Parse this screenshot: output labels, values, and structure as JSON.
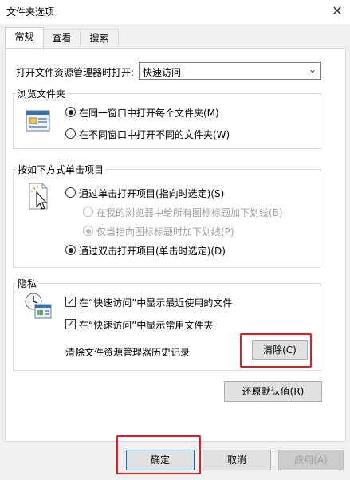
{
  "window": {
    "title": "文件夹选项",
    "close_glyph": "✕"
  },
  "tabs": [
    {
      "label": "常规",
      "active": true
    },
    {
      "label": "查看",
      "active": false
    },
    {
      "label": "搜索",
      "active": false
    }
  ],
  "open_explorer": {
    "label": "打开文件资源管理器时打开:",
    "value": "快速访问"
  },
  "browse_folders": {
    "title": "浏览文件夹",
    "options": [
      {
        "label": "在同一窗口中打开每个文件夹(M)",
        "selected": true
      },
      {
        "label": "在不同窗口中打开不同的文件夹(W)",
        "selected": false
      }
    ]
  },
  "click_items": {
    "title": "按如下方式单击项目",
    "single": {
      "label": "通过单击打开项目(指向时选定)(S)",
      "selected": false
    },
    "sub_underline_all": {
      "label": "在我的浏览器中给所有图标标题加下划线(B)",
      "selected": false
    },
    "sub_underline_hover": {
      "label": "仅当指向图标标题时加下划线(P)",
      "selected": true
    },
    "double": {
      "label": "通过双击打开项目(单击时选定)(D)",
      "selected": true
    }
  },
  "privacy": {
    "title": "隐私",
    "show_recent": {
      "label": "在“快速访问”中显示最近使用的文件",
      "checked": true
    },
    "show_frequent": {
      "label": "在“快速访问”中显示常用文件夹",
      "checked": true
    },
    "clear_history_label": "清除文件资源管理器历史记录",
    "clear_button": "清除(C)"
  },
  "restore_defaults_button": "还原默认值(R)",
  "footer": {
    "ok": "确定",
    "cancel": "取消",
    "apply": "应用(A)"
  },
  "colors": {
    "highlight": "#e51c1c",
    "accent": "#0078d7"
  }
}
